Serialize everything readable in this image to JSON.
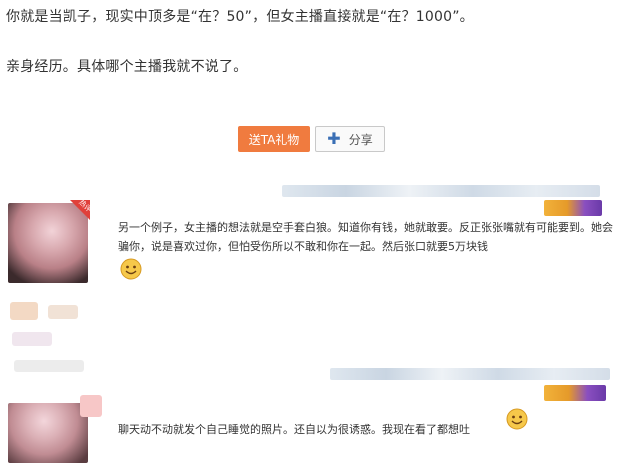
{
  "post": {
    "line1": "你就是当凯子，现实中顶多是“在？50”，但女主播直接就是“在？1000”。",
    "line2": "亲身经历。具体哪个主播我就不说了。"
  },
  "actions": {
    "gift_label": "送TA礼物",
    "share_label": "分享"
  },
  "comments": [
    {
      "text": "另一个例子，女主播的想法就是空手套白狼。知道你有钱，她就敢要。反正张张嘴就有可能要到。她会骗你，说是喜欢过你，但怕受伤所以不敢和你在一起。然后张口就要5万块钱",
      "emoji": "smile-emoji"
    },
    {
      "text": "聊天动不动就发个自己睡觉的照片。还自以为很诱惑。我现在看了都想吐",
      "emoji": "smile-emoji"
    }
  ],
  "avatar_badge": "热评",
  "colors": {
    "gift_bg": "#f07b3f",
    "share_plus": "#3a6fb5",
    "badge_red": "#e0403a"
  }
}
